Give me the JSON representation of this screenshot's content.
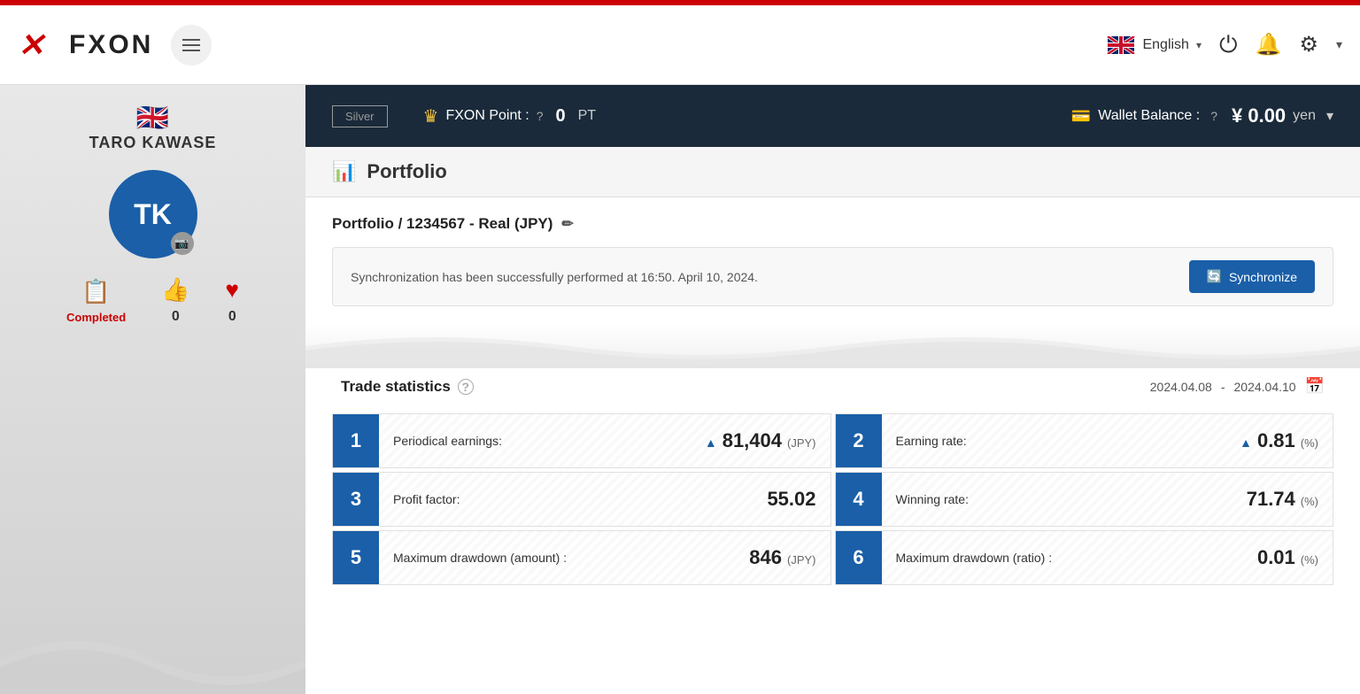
{
  "topBar": {
    "color": "#cc0000"
  },
  "header": {
    "logo": {
      "x_symbol": "✕",
      "fxon_text": "FXON"
    },
    "hamburger_label": "Menu",
    "language": {
      "name": "English",
      "dropdown_arrow": "▾"
    },
    "icons": {
      "power": "⏻",
      "bell": "🔔",
      "settings": "⚙"
    }
  },
  "sidebar": {
    "flag_emoji": "🇬🇧",
    "user_name": "TARO KAWASE",
    "avatar_initials": "TK",
    "camera_icon": "📷",
    "stats": [
      {
        "icon": "📋",
        "label": "Completed",
        "is_label": true
      },
      {
        "icon": "👍",
        "value": "0",
        "is_value": true
      },
      {
        "icon": "♥",
        "value": "0",
        "is_value": true
      }
    ]
  },
  "darkBar": {
    "badge_label": "Silver",
    "fxon_point_label": "FXON Point :",
    "fxon_point_value": "0",
    "fxon_point_unit": "PT",
    "wallet_label": "Wallet Balance :",
    "wallet_value": "¥ 0.00",
    "wallet_currency": "yen",
    "help_icon": "?"
  },
  "portfolio": {
    "section_title": "Portfolio",
    "subtitle": "Portfolio / 1234567 - Real (JPY)",
    "sync_message": "Synchronization has been successfully performed at 16:50. April 10, 2024.",
    "sync_button_label": "Synchronize",
    "trade_stats_title": "Trade statistics",
    "date_range_start": "2024.04.08",
    "date_range_separator": "-",
    "date_range_end": "2024.04.10",
    "stats": [
      {
        "badge_num": "1",
        "label": "Periodical earnings:",
        "value": "81,404",
        "arrow": "▲",
        "unit": "(JPY)"
      },
      {
        "badge_num": "2",
        "label": "Earning rate:",
        "value": "0.81",
        "arrow": "▲",
        "unit": "(%)"
      },
      {
        "badge_num": "3",
        "label": "Profit factor:",
        "value": "55.02",
        "arrow": "",
        "unit": ""
      },
      {
        "badge_num": "4",
        "label": "Winning rate:",
        "value": "71.74",
        "arrow": "",
        "unit": "(%)"
      },
      {
        "badge_num": "5",
        "label": "Maximum drawdown (amount) :",
        "value": "846",
        "arrow": "",
        "unit": "(JPY)"
      },
      {
        "badge_num": "6",
        "label": "Maximum drawdown (ratio) :",
        "value": "0.01",
        "arrow": "",
        "unit": "(%)"
      }
    ]
  }
}
